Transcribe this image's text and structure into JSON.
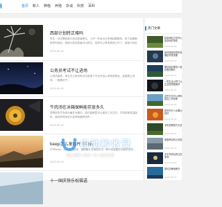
{
  "site": {
    "logo": "网"
  },
  "nav": [
    {
      "label": "首页",
      "active": true
    },
    {
      "label": "新人",
      "active": false
    },
    {
      "label": "种植",
      "active": false
    },
    {
      "label": "养殖",
      "active": false
    },
    {
      "label": "杂谈",
      "active": false
    },
    {
      "label": "科技",
      "active": false
    },
    {
      "label": "百科",
      "active": false
    }
  ],
  "articles": [
    {
      "title": "西部计划转正难吗",
      "excerpt": "学生一旦应聘西部计划志愿者职位，工作一年后可以申请延期服务，到了延期服务的时间后，西部计划志愿者可以转正，这样可以考虑其他工作了。西部计划志愿者，本职工作是...",
      "date": "2023-05-16"
    },
    {
      "title": "公务员考试不让进场",
      "excerpt": "公务员面考，考生在公务员考试中若带了不允许进入考场的物品，会被禁止进场，一般情况下...",
      "date": "2023-05-16"
    },
    {
      "title": "牛肉汤在冰箱保鲜能存放多久",
      "excerpt": "将熬好的牛肉汤冷藏在冰箱中，放在保鲜层可以保存三天左右。牛肉汤宜低温保存，保存的时间过长会导致营养流失...",
      "date": "2023-05-16"
    },
    {
      "title": "keep怎么发图片的动态",
      "excerpt": "打开keep，点击发布动态，选择图片并添加文字，即可完成图片动态的发布...",
      "date": "2023-05-16"
    },
    {
      "title": "十一国庆快乐祝福语",
      "excerpt": "",
      "date": ""
    }
  ],
  "sidebar": {
    "title": "热门文章",
    "items": [
      {
        "text": "精选润毛方法可以告诉你的事情",
        "date": "2023-05-16"
      },
      {
        "text": "如何挑选好看的衣服是非常重要",
        "date": "2023-05-16"
      },
      {
        "text": "微信朋友圈怎么发好看的照片",
        "date": "2023-05-16"
      },
      {
        "text": "一些生活小窍门让生活变得更美好",
        "date": "2023-05-16"
      },
      {
        "text": "这些方法可以帮你提高工作效率",
        "date": "2023-05-16"
      },
      {
        "text": "夏天吃什么水果比较好",
        "date": "2023-05-16"
      },
      {
        "text": "手机拍照技巧大全",
        "date": "2023-05-16"
      },
      {
        "text": "家庭养花的小妙招",
        "date": "2023-05-16"
      },
      {
        "text": "天平完成后的注意事项",
        "date": "2023-05-16"
      },
      {
        "text": "如何正确地刷牙",
        "date": "2023-05-16"
      }
    ]
  },
  "watermark": {
    "main": "自动秒收录",
    "sub": "线上链接→来访一次→自动收录"
  }
}
